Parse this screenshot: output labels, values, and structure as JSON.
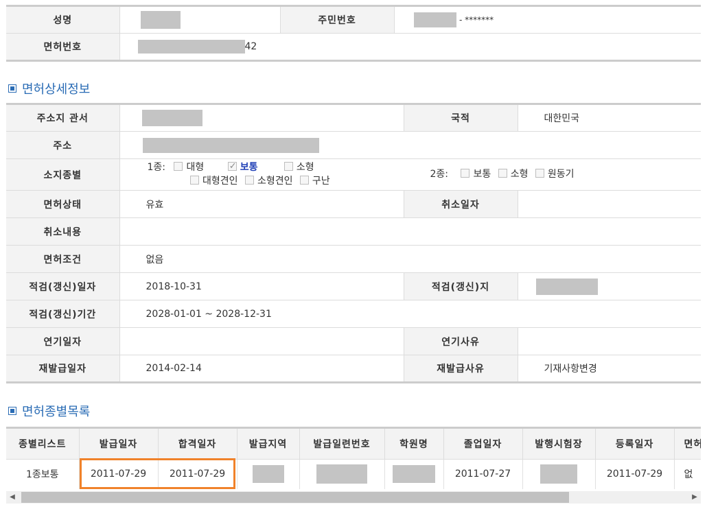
{
  "top": {
    "name_label": "성명",
    "rrn_label": "주민번호",
    "rrn_suffix": "- *******",
    "license_no_label": "면허번호",
    "license_no_tail": "42"
  },
  "detail_section": {
    "title": "면허상세정보"
  },
  "detail": {
    "office_label": "주소지 관서",
    "nationality_label": "국적",
    "nationality_value": "대한민국",
    "address_label": "주소",
    "type_label": "소지종별",
    "class1_label": "1종:",
    "class1_opts": [
      "대형",
      "보통",
      "소형",
      "대형견인",
      "소형견인",
      "구난"
    ],
    "class2_label": "2종:",
    "class2_opts": [
      "보통",
      "소형",
      "원동기"
    ],
    "status_label": "면허상태",
    "status_value": "유효",
    "cancel_date_label": "취소일자",
    "cancel_content_label": "취소내용",
    "condition_label": "면허조건",
    "condition_value": "없음",
    "renew_date_label": "적검(갱신)일자",
    "renew_date_value": "2018-10-31",
    "renew_place_label": "적검(갱신)지",
    "renew_period_label": "적검(갱신)기간",
    "renew_period_value": "2028-01-01 ~ 2028-12-31",
    "delay_date_label": "연기일자",
    "delay_reason_label": "연기사유",
    "reissue_date_label": "재발급일자",
    "reissue_date_value": "2014-02-14",
    "reissue_reason_label": "재발급사유",
    "reissue_reason_value": "기재사항변경"
  },
  "list_section": {
    "title": "면허종별목록"
  },
  "list": {
    "headers": [
      "종별리스트",
      "발급일자",
      "합격일자",
      "발급지역",
      "발급일련번호",
      "학원명",
      "졸업일자",
      "발행시험장",
      "등록일자",
      "면허"
    ],
    "row": [
      "1종보통",
      "2011-07-29",
      "2011-07-29",
      "",
      "",
      "",
      "2011-07-27",
      "",
      "2011-07-29",
      "없"
    ]
  },
  "colors": {
    "section_title": "#2a6cb5",
    "highlight": "#f0822a",
    "mask": "#c4c4c4",
    "checked_label": "#1f3fb6"
  }
}
